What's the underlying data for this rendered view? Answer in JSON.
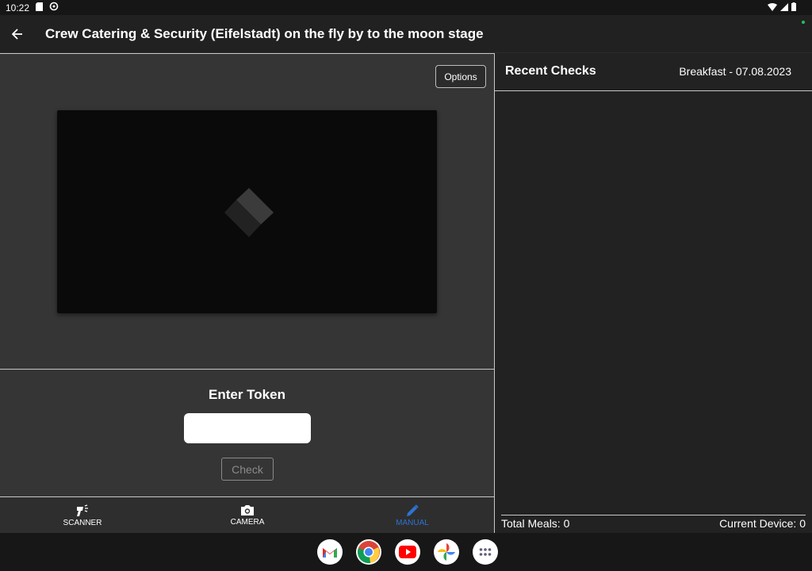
{
  "statusbar": {
    "time": "10:22"
  },
  "appbar": {
    "title": "Crew Catering & Security (Eifelstadt) on the fly by to the moon stage"
  },
  "camera": {
    "options_label": "Options"
  },
  "token": {
    "title": "Enter Token",
    "input_value": "",
    "input_placeholder": "",
    "check_label": "Check"
  },
  "bottom_nav": {
    "items": [
      {
        "label": "SCANNER",
        "icon": "barcode-scanner-icon",
        "active": false
      },
      {
        "label": "CAMERA",
        "icon": "camera-icon",
        "active": false
      },
      {
        "label": "MANUAL",
        "icon": "pencil-icon",
        "active": true
      }
    ],
    "active_color": "#2e72d2"
  },
  "recent": {
    "title": "Recent Checks",
    "meal": "Breakfast  - 07.08.2023",
    "total_meals": "Total Meals: 0",
    "current_device": "Current Device: 0"
  },
  "dock": {
    "apps": [
      "gmail-icon",
      "chrome-icon",
      "youtube-icon",
      "photos-icon",
      "app-drawer-icon"
    ]
  }
}
